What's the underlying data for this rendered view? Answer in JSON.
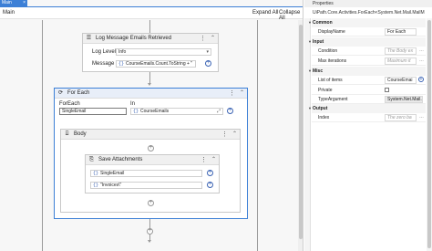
{
  "designer": {
    "tab_label": "Main",
    "breadcrumb": "Main",
    "expand_all": "Expand All",
    "collapse_all": "Collapse All"
  },
  "log_message": {
    "title": "Log Message Emails Retrieved",
    "log_level_label": "Log Level",
    "log_level_value": "Info",
    "message_label": "Message",
    "message_value": "CourseEmails.Count.ToString + \""
  },
  "for_each": {
    "title": "For Each",
    "foreach_label": "ForEach",
    "foreach_value": "SingleEmail",
    "in_label": "In",
    "in_value": "CourseEmails"
  },
  "body": {
    "title": "Body"
  },
  "save_attachments": {
    "title": "Save Attachments",
    "message_value": "SingleEmail",
    "folder_value": "\"Invoices\\\""
  },
  "properties": {
    "title": "Properties",
    "type_name": "UiPath.Core.Activities.ForEach<System.Net.Mail.MailM",
    "rows": {
      "common": "Common",
      "display_name_key": "DisplayName",
      "display_name_value": "For Each",
      "input": "Input",
      "condition_key": "Condition",
      "condition_value": "The Body ex",
      "max_iterations_key": "Max iterations",
      "max_iterations_value": "Maximum it",
      "misc": "Misc",
      "list_of_items_key": "List of items",
      "list_of_items_value": "CourseEmai",
      "private_key": "Private",
      "type_argument_key": "TypeArgument",
      "type_argument_value": "System.Net.Mail.M",
      "output": "Output",
      "index_key": "Index",
      "index_value": "The zero ba"
    }
  }
}
